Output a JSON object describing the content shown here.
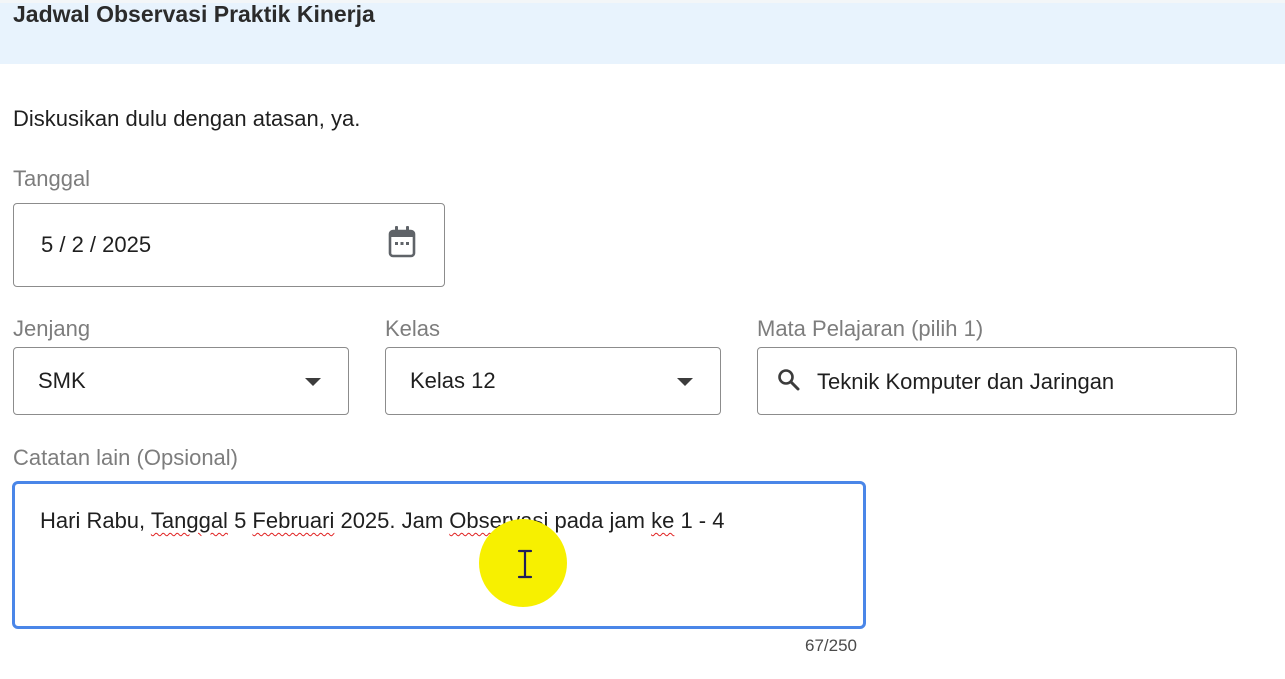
{
  "header": {
    "title": "Jadwal Observasi Praktik Kinerja"
  },
  "intro": {
    "text": "Diskusikan dulu dengan atasan, ya."
  },
  "date_field": {
    "label": "Tanggal",
    "value": "5 / 2 / 2025",
    "icon": "calendar-icon"
  },
  "jenjang_field": {
    "label": "Jenjang",
    "value": "SMK",
    "icon": "dropdown-arrow-icon"
  },
  "kelas_field": {
    "label": "Kelas",
    "value": "Kelas 12",
    "icon": "dropdown-arrow-icon"
  },
  "mapel_field": {
    "label": "Mata Pelajaran (pilih 1)",
    "value": "Teknik Komputer dan Jaringan",
    "icon": "search-icon"
  },
  "notes_field": {
    "label": "Catatan lain (Opsional)",
    "segments": [
      "Hari Rabu, ",
      "Tanggal",
      " 5 ",
      "Februari",
      " 2025. Jam ",
      "Observasi",
      " pada jam ",
      "ke",
      " 1 - 4"
    ],
    "counter": "67/250"
  },
  "colors": {
    "header_bg": "#e8f3fd",
    "focus_border": "#4a86e8",
    "cursor_highlight": "#f7f000"
  }
}
